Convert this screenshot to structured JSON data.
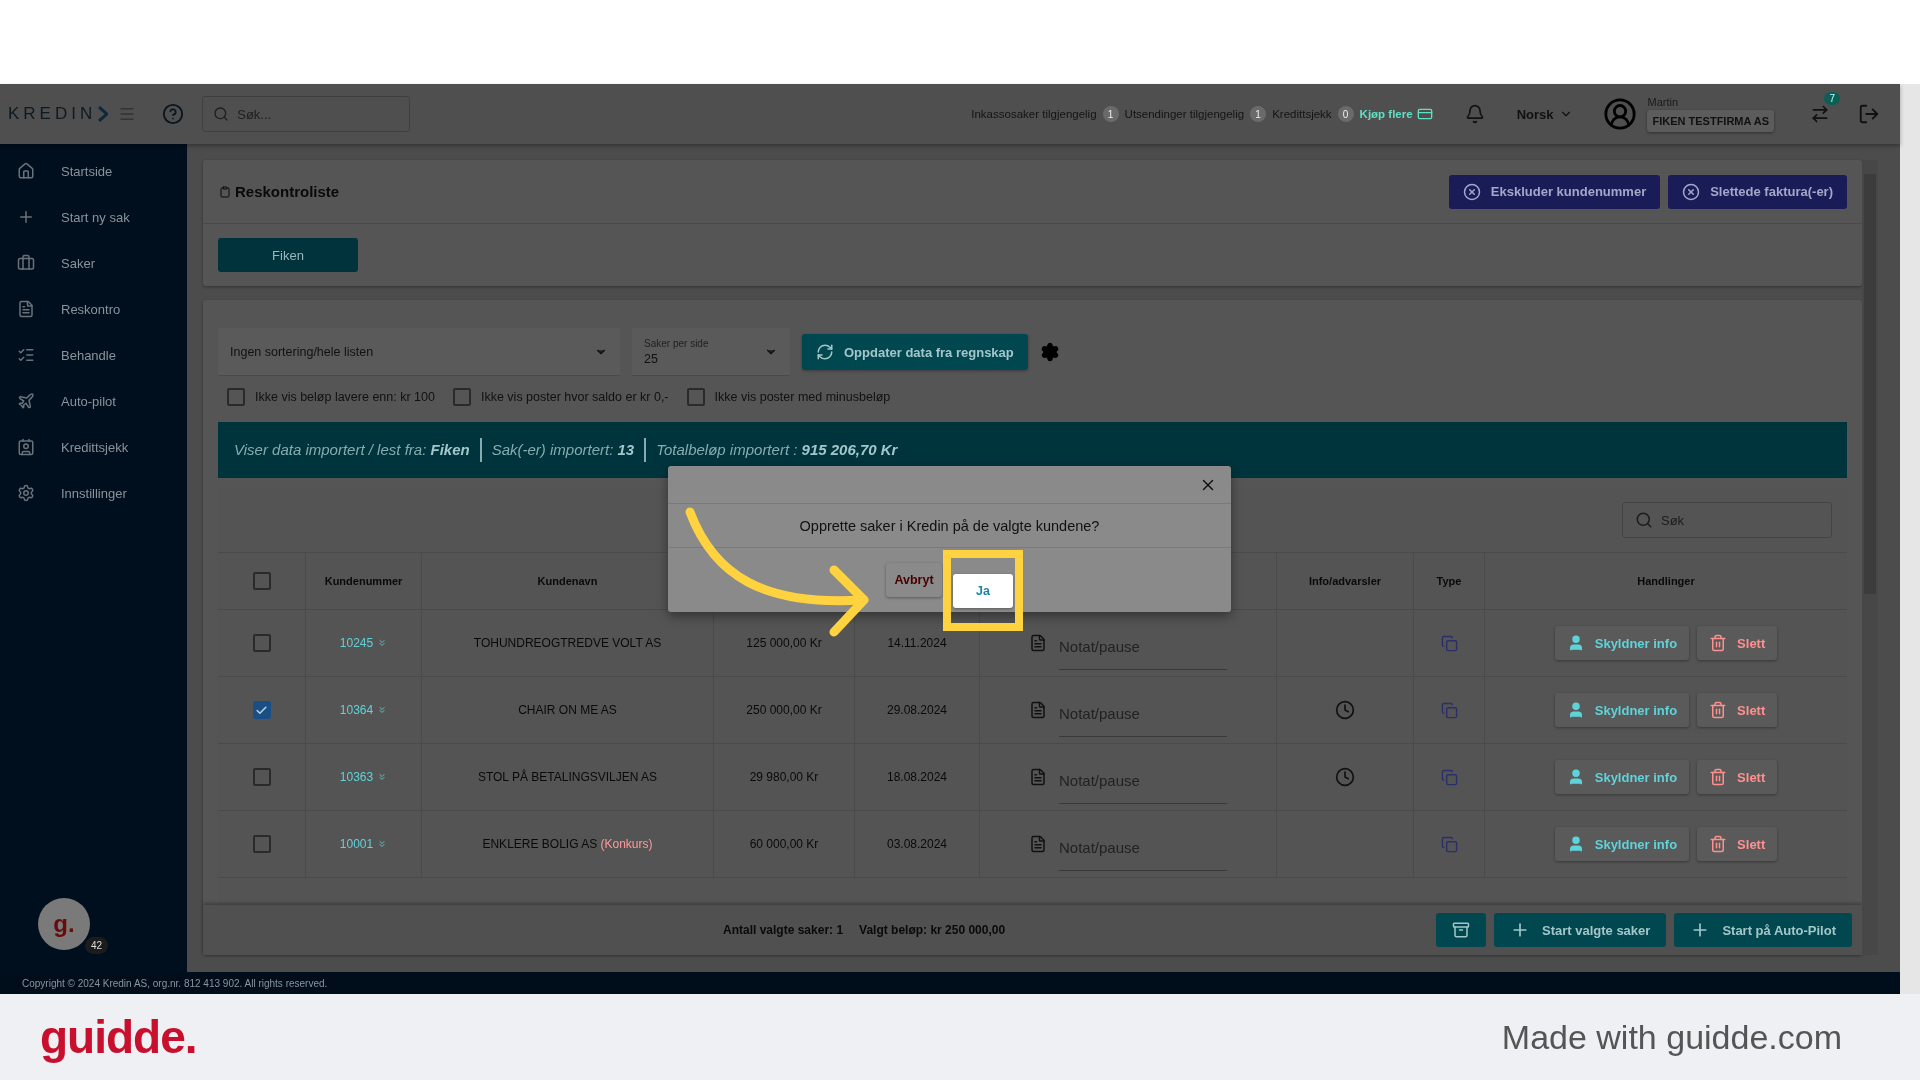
{
  "header": {
    "logo": "KREDIN",
    "search_placeholder": "Søk...",
    "counters": [
      {
        "label": "Inkassosaker tilgjengelig",
        "count": "1"
      },
      {
        "label": "Utsendinger tilgjengelig",
        "count": "1"
      },
      {
        "label": "Kredittsjekk",
        "count": "0"
      }
    ],
    "buy_more": "Kjøp flere",
    "language": "Norsk",
    "user": {
      "name": "Martin",
      "company": "FIKEN TESTFIRMA AS"
    },
    "transfer_badge": "7"
  },
  "sidebar": {
    "items": [
      {
        "label": "Startside"
      },
      {
        "label": "Start ny sak"
      },
      {
        "label": "Saker"
      },
      {
        "label": "Reskontro"
      },
      {
        "label": "Behandle"
      },
      {
        "label": "Auto-pilot"
      },
      {
        "label": "Kredittsjekk"
      },
      {
        "label": "Innstillinger"
      }
    ],
    "avatar": {
      "letter": "g.",
      "badge": "42"
    }
  },
  "page": {
    "title": "Reskontroliste",
    "actions": [
      "Ekskluder kundenummer",
      "Slettede faktura(-er)"
    ],
    "sources": [
      {
        "label": "Fiken",
        "selected": true
      }
    ]
  },
  "filters": {
    "sort": "Ingen sortering/hele listen",
    "per_page": {
      "label": "Saker per side",
      "value": "25"
    },
    "refresh": "Oppdater data fra regnskap",
    "checkboxes": [
      {
        "label": "Ikke vis beløp lavere enn: kr 100",
        "checked": false
      },
      {
        "label": "Ikke vis poster hvor saldo er kr 0,-",
        "checked": false
      },
      {
        "label": "Ikke vis poster med minusbeløp",
        "checked": false
      }
    ]
  },
  "banner": [
    "Viser data importert / lest fra: **Fiken**",
    "Sak(-er) importert:  **13**",
    "Totalbeløp importert :  **915 206,70 Kr**"
  ],
  "table": {
    "search_placeholder": "Søk",
    "header_checked": false,
    "columns": [
      "Kundenummer",
      "Kundenavn",
      "Info/advarsler",
      "Type",
      "Handlinger"
    ],
    "rows": [
      {
        "checked": false,
        "number": "10245",
        "name": "TOHUNDREOGTREDVE VOLT AS",
        "amount": "125 000,00 Kr",
        "date": "14.11.2024",
        "note_placeholder": "Notat/pause",
        "clock": false,
        "actions": [
          "Skyldner info",
          "Slett"
        ]
      },
      {
        "checked": true,
        "number": "10364",
        "name": "CHAIR ON ME AS",
        "amount": "250 000,00 Kr",
        "date": "29.08.2024",
        "note_placeholder": "Notat/pause",
        "clock": true,
        "actions": [
          "Skyldner info",
          "Slett"
        ]
      },
      {
        "checked": false,
        "number": "10363",
        "name": "STOL PÅ BETALINGSVILJEN AS",
        "amount": "29 980,00 Kr",
        "date": "18.08.2024",
        "note_placeholder": "Notat/pause",
        "clock": true,
        "actions": [
          "Skyldner info",
          "Slett"
        ]
      },
      {
        "checked": false,
        "number": "10001",
        "name": "ENKLERE BOLIG AS",
        "tag": "(Konkurs)",
        "amount": "60 000,00 Kr",
        "date": "03.08.2024",
        "note_placeholder": "Notat/pause",
        "clock": false,
        "actions": [
          "Skyldner info",
          "Slett"
        ]
      }
    ]
  },
  "bottom_bar": {
    "summary": [
      "Antall valgte saker: 1",
      "Valgt beløp: kr 250 000,00"
    ],
    "buttons": [
      "Start valgte saker",
      "Start på Auto-Pilot"
    ]
  },
  "copyright": "Copyright © 2024 Kredin AS, org.nr. 812 413 902. All rights reserved.",
  "modal": {
    "question": "Opprette saker i Kredin på de valgte kundene?",
    "buttons": [
      {
        "label": "Avbryt",
        "kind": "cancel"
      },
      {
        "label": "Ja",
        "kind": "confirm"
      }
    ]
  },
  "caption_bar": {
    "logo": "guidde.",
    "text": "Made with guidde.com"
  }
}
